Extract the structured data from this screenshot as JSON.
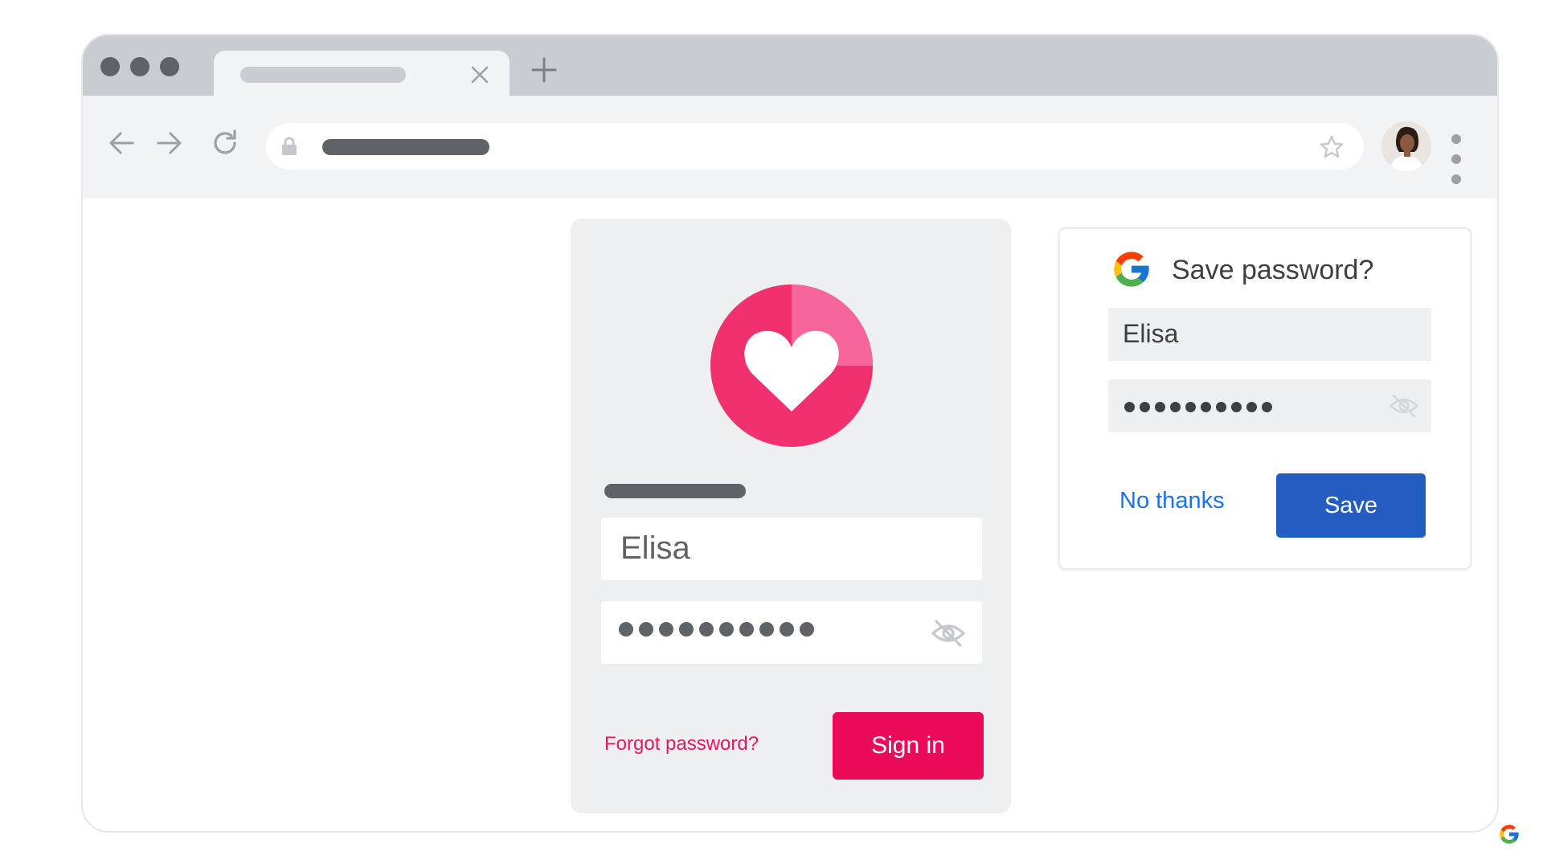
{
  "browser": {
    "window_controls": [
      "close",
      "minimize",
      "maximize"
    ],
    "tab": {
      "close_icon": "close-icon"
    },
    "new_tab_icon": "plus-icon",
    "nav_icons": [
      "back-arrow-icon",
      "forward-arrow-icon",
      "reload-icon"
    ],
    "omnibox": {
      "lock_icon": "lock-icon",
      "bookmark_icon": "star-icon"
    },
    "menu_icon": "kebab-menu-icon"
  },
  "login_form": {
    "logo_icon": "heart-icon",
    "username_value": "Elisa",
    "password_masked_length": 10,
    "visibility_icon": "eye-off-icon",
    "forgot_label": "Forgot password?",
    "signin_label": "Sign in",
    "accent": "#ea0a57"
  },
  "save_password_dialog": {
    "brand_icon": "google-g-icon",
    "title": "Save password?",
    "username_value": "Elisa",
    "password_masked_length": 10,
    "visibility_icon": "eye-off-icon",
    "dismiss_label": "No thanks",
    "save_label": "Save",
    "accent": "#245cc2",
    "link_color": "#1a73e8"
  }
}
